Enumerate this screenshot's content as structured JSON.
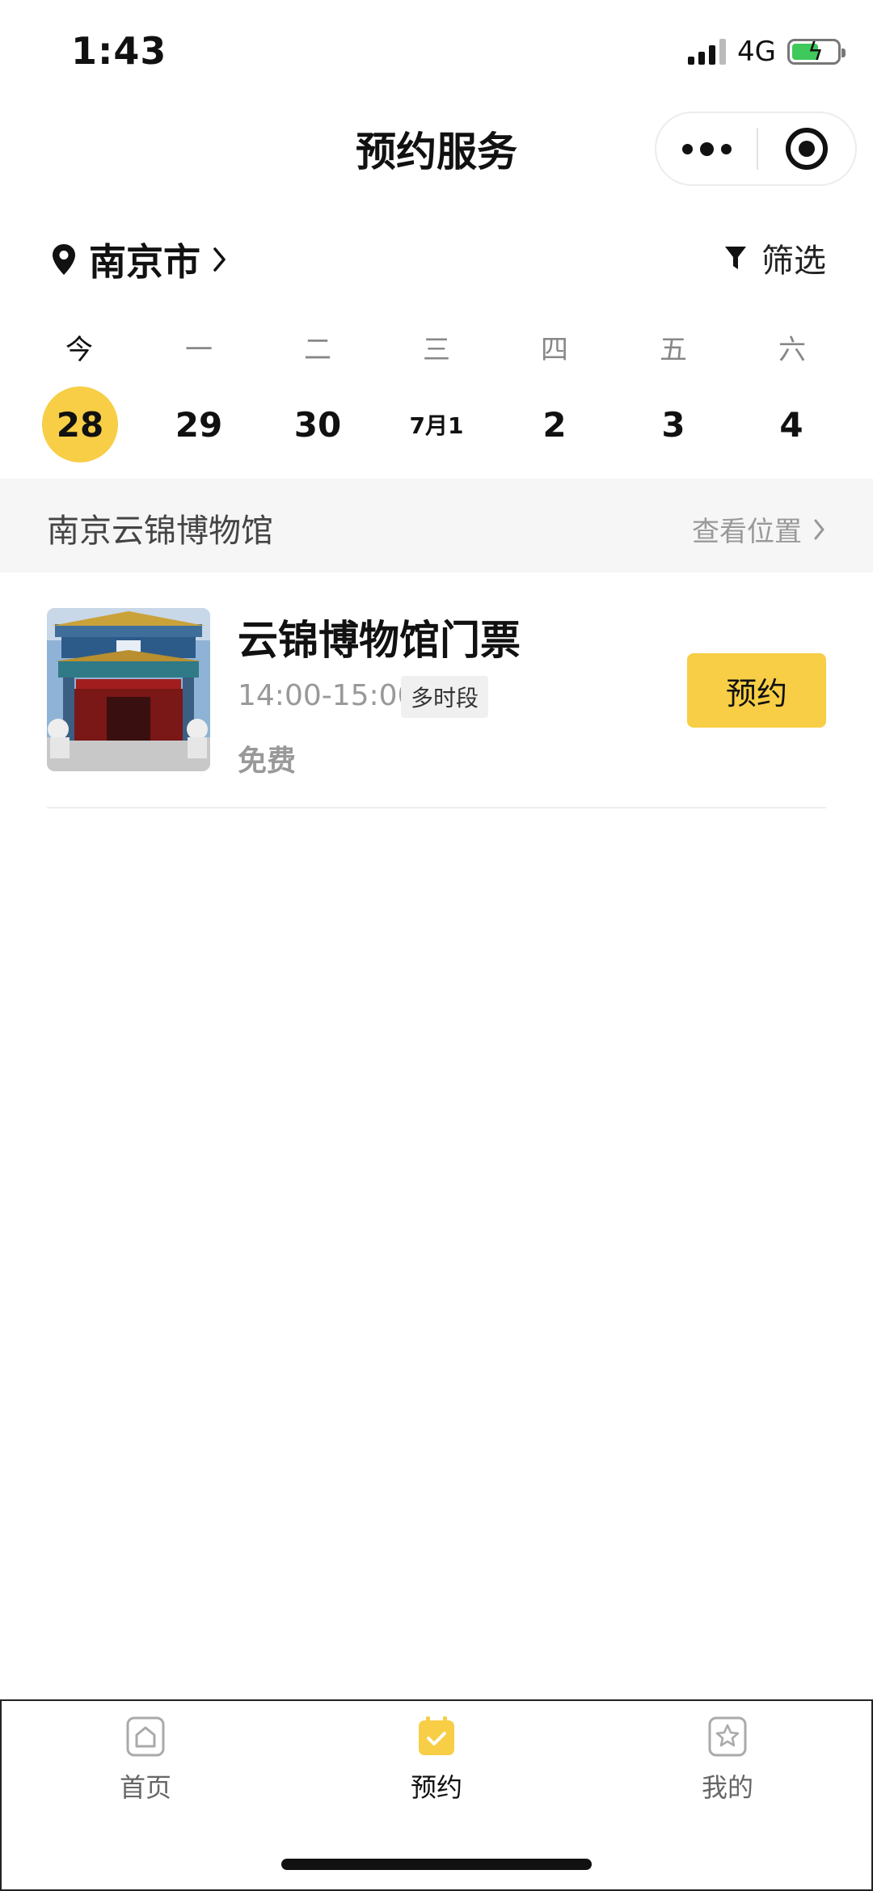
{
  "status_bar": {
    "time": "1:43",
    "network": "4G"
  },
  "nav": {
    "title": "预约服务",
    "more_icon": "more-dots-icon",
    "close_icon": "target-circle-icon"
  },
  "location": {
    "city": "南京市",
    "icon": "location-pin-icon"
  },
  "filter": {
    "label": "筛选",
    "icon": "funnel-icon"
  },
  "calendar": {
    "weekdays": [
      "今",
      "一",
      "二",
      "三",
      "四",
      "五",
      "六"
    ],
    "dates": [
      "28",
      "29",
      "30",
      "7月1",
      "2",
      "3",
      "4"
    ],
    "selected_index": 0
  },
  "venue": {
    "name": "南京云锦博物馆",
    "location_link": "查看位置"
  },
  "ticket": {
    "title": "云锦博物馆门票",
    "time": "14:00-15:00",
    "tag": "多时段",
    "price": "免费",
    "button": "预约"
  },
  "tabbar": {
    "tabs": [
      {
        "label": "首页",
        "icon": "home-icon"
      },
      {
        "label": "预约",
        "icon": "calendar-check-icon"
      },
      {
        "label": "我的",
        "icon": "star-profile-icon"
      }
    ],
    "active_index": 1
  },
  "colors": {
    "accent": "#f7ce46",
    "muted_text": "#999999",
    "venue_bg": "#f6f6f6"
  }
}
